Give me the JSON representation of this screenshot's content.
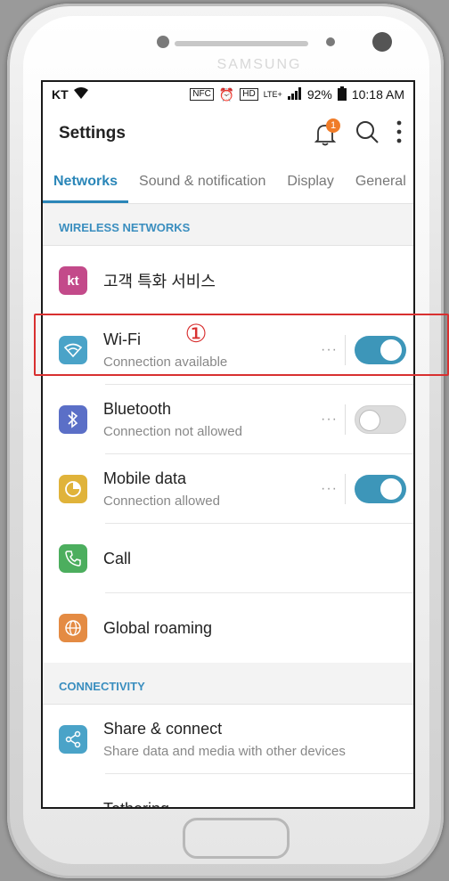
{
  "device": {
    "brand": "SAMSUNG"
  },
  "status_bar": {
    "carrier": "KT",
    "battery": "92%",
    "time": "10:18 AM",
    "network": "LTE+",
    "nfc": "NFC",
    "hd": "HD"
  },
  "app_bar": {
    "title": "Settings",
    "notification_count": "1"
  },
  "tabs": [
    {
      "label": "Networks",
      "active": true
    },
    {
      "label": "Sound & notification",
      "active": false
    },
    {
      "label": "Display",
      "active": false
    },
    {
      "label": "General",
      "active": false
    }
  ],
  "sections": {
    "wireless": {
      "header": "WIRELESS NETWORKS",
      "items": [
        {
          "title": "고객 특화 서비스",
          "subtitle": "",
          "icon": "kt-logo-icon",
          "icon_text": "kt",
          "color": "#c34a8a"
        },
        {
          "title": "Wi-Fi",
          "subtitle": "Connection available",
          "icon": "wifi-icon",
          "color": "#4aa3c8",
          "toggle": true
        },
        {
          "title": "Bluetooth",
          "subtitle": "Connection not allowed",
          "icon": "bluetooth-icon",
          "color": "#5b6fc7",
          "toggle": false
        },
        {
          "title": "Mobile data",
          "subtitle": "Connection allowed",
          "icon": "mobile-data-icon",
          "color": "#e0b33a",
          "toggle": true
        },
        {
          "title": "Call",
          "subtitle": "",
          "icon": "phone-icon",
          "color": "#4cae5e"
        },
        {
          "title": "Global roaming",
          "subtitle": "",
          "icon": "globe-icon",
          "color": "#e48b43"
        }
      ]
    },
    "connectivity": {
      "header": "CONNECTIVITY",
      "items": [
        {
          "title": "Share & connect",
          "subtitle": "Share data and media with other devices",
          "icon": "share-icon",
          "color": "#4aa3c8"
        },
        {
          "title": "Tethering",
          "subtitle": ""
        }
      ]
    }
  },
  "annotation": {
    "label": "①"
  },
  "more_glyph": "···"
}
